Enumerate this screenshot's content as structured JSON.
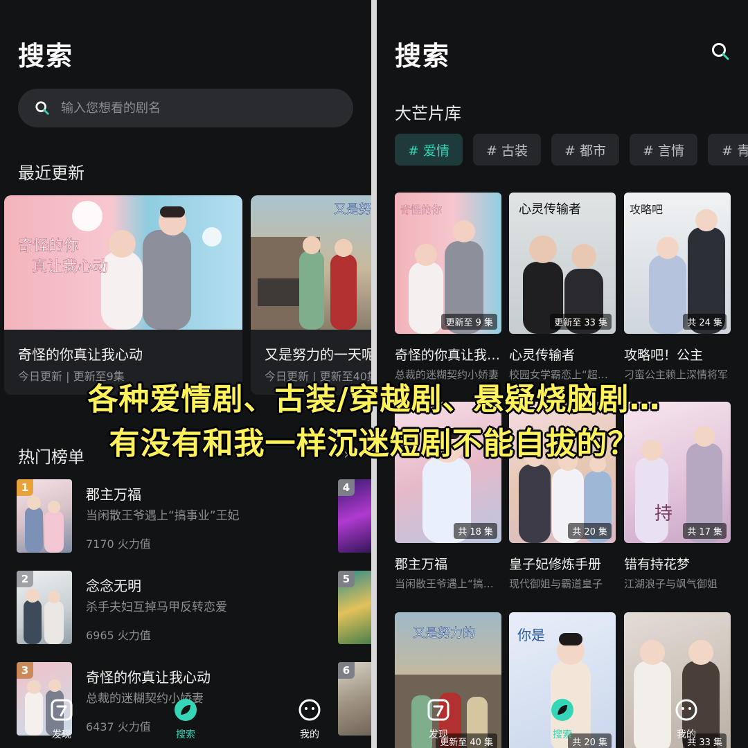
{
  "left": {
    "title": "搜索",
    "search": {
      "placeholder": "输入您想看的剧名"
    },
    "recent_section": "最近更新",
    "recent": [
      {
        "title": "奇怪的你真让我心动",
        "sub": "今日更新 | 更新至9集"
      },
      {
        "title": "又是努力的一天呢",
        "sub": "今日更新 | 更新至40集"
      }
    ],
    "hot_section": "热门榜单",
    "hot": [
      {
        "rank": "1",
        "name": "郡主万福",
        "desc": "当闲散王爷遇上“搞事业”王妃",
        "heat": "7170 火力值"
      },
      {
        "rank": "2",
        "name": "念念无明",
        "desc": "杀手夫妇互掉马甲反转恋爱",
        "heat": "6965 火力值"
      },
      {
        "rank": "3",
        "name": "奇怪的你真让我心动",
        "desc": "总裁的迷糊契约小娇妻",
        "heat": "6437 火力值"
      }
    ],
    "hot_peek_ranks": [
      "4",
      "5",
      "6"
    ]
  },
  "right": {
    "title": "搜索",
    "library": "大芒片库",
    "tags": [
      "# 爱情",
      "# 古装",
      "# 都市",
      "# 言情",
      "# 青"
    ],
    "cards": [
      {
        "title": "奇怪的你真让我心动",
        "desc": "总裁的迷糊契约小娇妻",
        "badge": "更新至 9 集"
      },
      {
        "title": "心灵传输者",
        "desc": "校园女学霸恋上“超能力者”",
        "badge": "更新至 33 集"
      },
      {
        "title": "攻略吧！公主",
        "desc": "刁蛮公主赖上深情将军",
        "badge": "共 24 集"
      },
      {
        "title": "郡主万福",
        "desc": "当闲散王爷遇上“搞事业”王妃",
        "badge": "共 18 集"
      },
      {
        "title": "皇子妃修炼手册",
        "desc": "现代御姐与霸道皇子",
        "badge": "共 20 集"
      },
      {
        "title": "错有持花梦",
        "desc": "江湖浪子与飒气御姐",
        "badge": "共 17 集"
      },
      {
        "title": "",
        "desc": "",
        "badge": "更新至 40 集"
      },
      {
        "title": "",
        "desc": "",
        "badge": "共 20 集"
      },
      {
        "title": "",
        "desc": "",
        "badge": "共 33 集"
      }
    ]
  },
  "nav": {
    "discover": "发现",
    "search": "搜索",
    "mine": "我的"
  },
  "caption": {
    "line1": "各种爱情剧、古装/穿越剧、悬疑烧脑剧…",
    "line2": "有没有和我一样沉迷短剧不能自拔的？"
  },
  "colors": {
    "accent": "#35d6b8",
    "caption": "#fff25a",
    "background": "#121315"
  }
}
